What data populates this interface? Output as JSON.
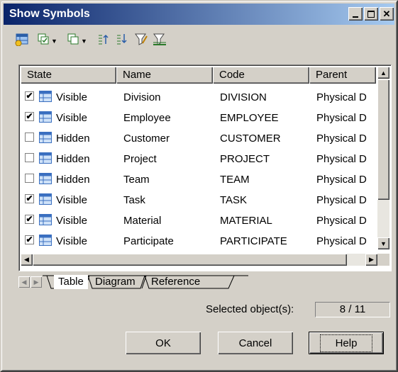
{
  "window": {
    "title": "Show Symbols"
  },
  "toolbar": {
    "icons": [
      "add-objects-icon",
      "select-all-icon",
      "deselect-icon",
      "move-up-icon",
      "move-down-icon",
      "filter-icon",
      "clear-filter-icon"
    ]
  },
  "table": {
    "columns": [
      "State",
      "Name",
      "Code",
      "Parent"
    ],
    "rows": [
      {
        "checked": true,
        "state": "Visible",
        "name": "Division",
        "code": "DIVISION",
        "parent": "Physical D"
      },
      {
        "checked": true,
        "state": "Visible",
        "name": "Employee",
        "code": "EMPLOYEE",
        "parent": "Physical D"
      },
      {
        "checked": false,
        "state": "Hidden",
        "name": "Customer",
        "code": "CUSTOMER",
        "parent": "Physical D"
      },
      {
        "checked": false,
        "state": "Hidden",
        "name": "Project",
        "code": "PROJECT",
        "parent": "Physical D"
      },
      {
        "checked": false,
        "state": "Hidden",
        "name": "Team",
        "code": "TEAM",
        "parent": "Physical D"
      },
      {
        "checked": true,
        "state": "Visible",
        "name": "Task",
        "code": "TASK",
        "parent": "Physical D"
      },
      {
        "checked": true,
        "state": "Visible",
        "name": "Material",
        "code": "MATERIAL",
        "parent": "Physical D"
      },
      {
        "checked": true,
        "state": "Visible",
        "name": "Participate",
        "code": "PARTICIPATE",
        "parent": "Physical D"
      }
    ]
  },
  "tabs": [
    "Table",
    "Diagram",
    "Reference"
  ],
  "active_tab": "Table",
  "selection": {
    "label": "Selected object(s):",
    "value": "8 / 11"
  },
  "buttons": {
    "ok": "OK",
    "cancel": "Cancel",
    "help": "Help"
  },
  "colors": {
    "title_start": "#0a246a",
    "title_end": "#a6caf0",
    "face": "#d4d0c8"
  }
}
